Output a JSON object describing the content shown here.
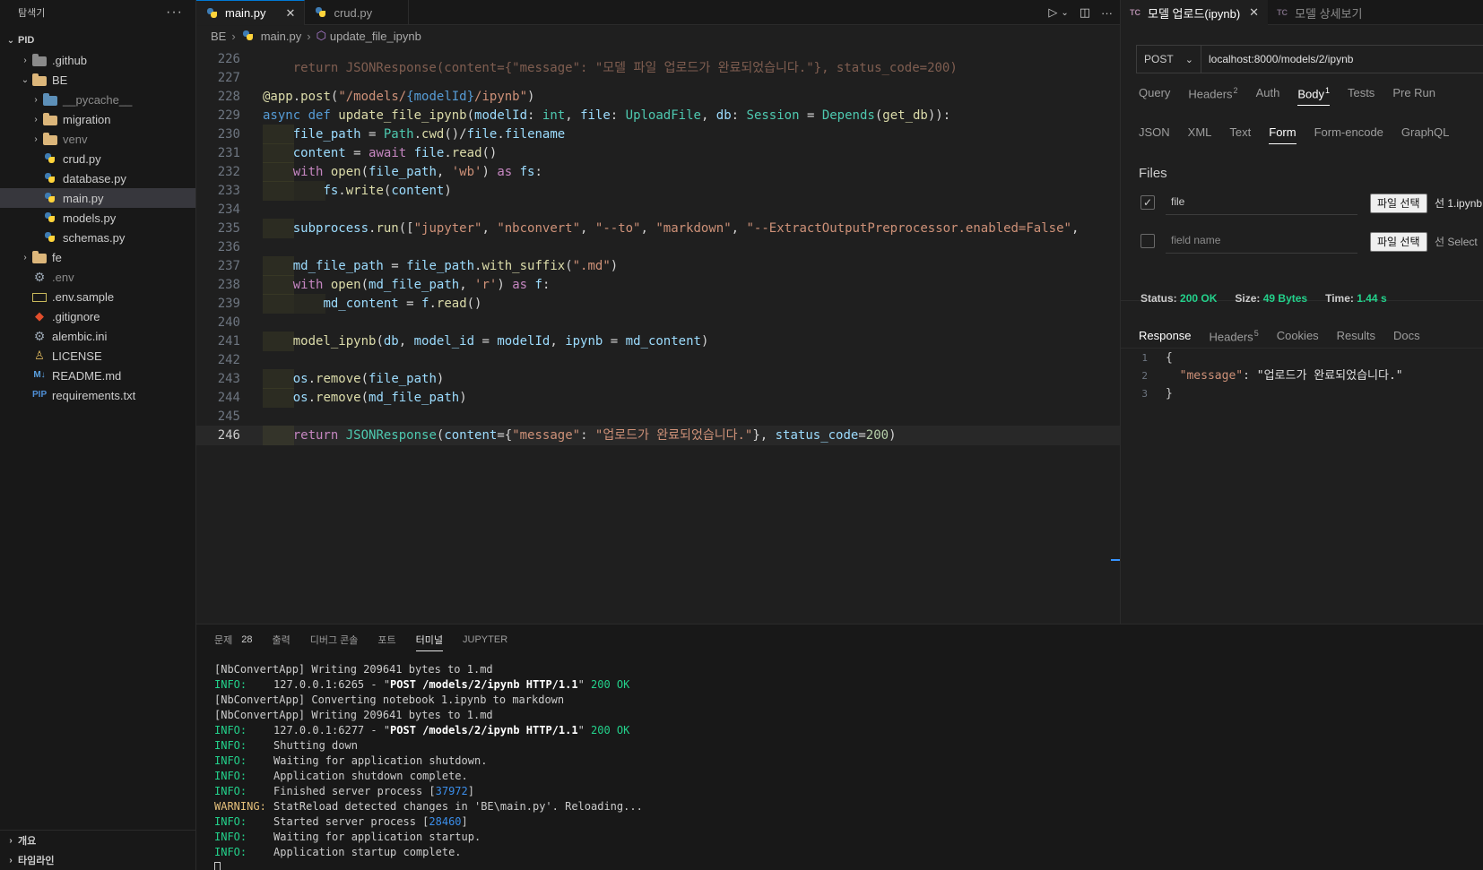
{
  "sidebar": {
    "title": "탐색기",
    "more": "···",
    "root": "PID",
    "items": [
      {
        "label": ".github",
        "kind": "folder-gh",
        "chev": "›",
        "indent": 1
      },
      {
        "label": "BE",
        "kind": "folder",
        "chev": "⌄",
        "indent": 1
      },
      {
        "label": "__pycache__",
        "kind": "folder-py",
        "chev": "›",
        "indent": 2,
        "dim": true
      },
      {
        "label": "migration",
        "kind": "folder",
        "chev": "›",
        "indent": 2
      },
      {
        "label": "venv",
        "kind": "folder",
        "chev": "›",
        "indent": 2,
        "dim": true
      },
      {
        "label": "crud.py",
        "kind": "py",
        "indent": 2
      },
      {
        "label": "database.py",
        "kind": "py",
        "indent": 2
      },
      {
        "label": "main.py",
        "kind": "py",
        "indent": 2,
        "selected": true
      },
      {
        "label": "models.py",
        "kind": "py",
        "indent": 2
      },
      {
        "label": "schemas.py",
        "kind": "py",
        "indent": 2
      },
      {
        "label": "fe",
        "kind": "folder",
        "chev": "›",
        "indent": 1
      },
      {
        "label": ".env",
        "kind": "gear",
        "indent": 1,
        "dim": true
      },
      {
        "label": ".env.sample",
        "kind": "env",
        "indent": 1
      },
      {
        "label": ".gitignore",
        "kind": "git",
        "indent": 1
      },
      {
        "label": "alembic.ini",
        "kind": "gear",
        "indent": 1
      },
      {
        "label": "LICENSE",
        "kind": "license",
        "indent": 1
      },
      {
        "label": "README.md",
        "kind": "md",
        "indent": 1
      },
      {
        "label": "requirements.txt",
        "kind": "req",
        "indent": 1
      }
    ],
    "bottom": [
      "개요",
      "타임라인"
    ]
  },
  "editor_tabs": [
    {
      "label": "main.py",
      "active": true,
      "close": "✕"
    },
    {
      "label": "crud.py",
      "active": false
    }
  ],
  "breadcrumb": [
    "BE",
    "main.py",
    "update_file_ipynb"
  ],
  "code": {
    "top_partial": "return JSONResponse(content={\"message\": \"모델 파일 업로드가 완료되었습니다.\"}, status_code=200)",
    "current_line": 246
  },
  "panel": {
    "tabs": [
      {
        "label": "문제",
        "badge": "28"
      },
      {
        "label": "출력"
      },
      {
        "label": "디버그 콘솔"
      },
      {
        "label": "포트"
      },
      {
        "label": "터미널",
        "active": true
      },
      {
        "label": "JUPYTER"
      }
    ],
    "terminal": [
      {
        "level": "",
        "text": "[NbConvertApp] Writing 209641 bytes to 1.md"
      },
      {
        "level": "INFO:",
        "pre": "127.0.0.1:6265 - \"",
        "path": "POST /models/2/ipynb HTTP/1.1",
        "post": "\" ",
        "ok": "200 OK"
      },
      {
        "level": "",
        "text": "[NbConvertApp] Converting notebook 1.ipynb to markdown"
      },
      {
        "level": "",
        "text": "[NbConvertApp] Writing 209641 bytes to 1.md"
      },
      {
        "level": "INFO:",
        "pre": "127.0.0.1:6277 - \"",
        "path": "POST /models/2/ipynb HTTP/1.1",
        "post": "\" ",
        "ok": "200 OK"
      },
      {
        "level": "INFO:",
        "text": "Shutting down"
      },
      {
        "level": "INFO:",
        "text": "Waiting for application shutdown."
      },
      {
        "level": "INFO:",
        "text": "Application shutdown complete."
      },
      {
        "level": "INFO:",
        "text": "Finished server process [",
        "num": "37972",
        "tail": "]"
      },
      {
        "level": "WARNING:",
        "text": "StatReload detected changes in 'BE\\main.py'. Reloading..."
      },
      {
        "level": "INFO:",
        "text": "Started server process [",
        "num": "28460",
        "tail": "]"
      },
      {
        "level": "INFO:",
        "text": "Waiting for application startup."
      },
      {
        "level": "INFO:",
        "text": "Application startup complete."
      }
    ]
  },
  "tc": {
    "tabs": [
      {
        "logo": "TC",
        "label": "모델 업로드(ipynb)",
        "active": true,
        "close": "✕"
      },
      {
        "logo": "TC",
        "label": "모델 상세보기",
        "active": false
      }
    ],
    "method": "POST",
    "url": "localhost:8000/models/2/ipynb",
    "request_tabs": [
      {
        "label": "Query"
      },
      {
        "label": "Headers",
        "sup": "2"
      },
      {
        "label": "Auth"
      },
      {
        "label": "Body",
        "sup": "1",
        "active": true
      },
      {
        "label": "Tests"
      },
      {
        "label": "Pre Run"
      }
    ],
    "body_tabs": [
      {
        "label": "JSON"
      },
      {
        "label": "XML"
      },
      {
        "label": "Text"
      },
      {
        "label": "Form",
        "active": true
      },
      {
        "label": "Form-encode"
      },
      {
        "label": "GraphQL"
      }
    ],
    "files_title": "Files",
    "files": [
      {
        "checked": true,
        "name": "file",
        "placeholder": "",
        "button": "파일 선택",
        "chosen": "선 1.ipynb"
      },
      {
        "checked": false,
        "name": "",
        "placeholder": "field name",
        "button": "파일 선택",
        "chosen": "선 Select"
      }
    ],
    "status": {
      "status_label": "Status:",
      "status_value": "200 OK",
      "size_label": "Size:",
      "size_value": "49 Bytes",
      "time_label": "Time:",
      "time_value": "1.44 s"
    },
    "response_tabs": [
      {
        "label": "Response",
        "active": true
      },
      {
        "label": "Headers",
        "sup": "5"
      },
      {
        "label": "Cookies"
      },
      {
        "label": "Results"
      },
      {
        "label": "Docs"
      }
    ],
    "response_body": {
      "line1": "{",
      "key": "\"message\"",
      "colon": ": ",
      "value": "\"업로드가 완료되었습니다.\"",
      "line3": "}"
    }
  }
}
